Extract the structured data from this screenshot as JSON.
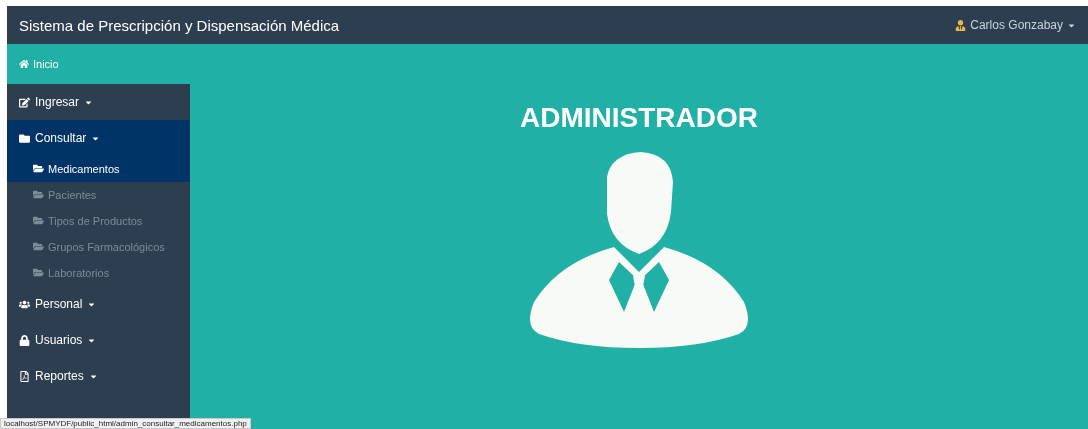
{
  "navbar": {
    "title": "Sistema de Prescripción y Dispensación Médica",
    "user": "Carlos Gonzabay"
  },
  "home_link": {
    "label": "Inicio"
  },
  "sidebar": {
    "items": [
      {
        "label": "Ingresar",
        "selected": false
      },
      {
        "label": "Consultar",
        "selected": true,
        "children": [
          {
            "label": "Medicamentos",
            "selected": true
          },
          {
            "label": "Pacientes",
            "selected": false
          },
          {
            "label": "Tipos de Productos",
            "selected": false
          },
          {
            "label": "Grupos Farmacológicos",
            "selected": false
          },
          {
            "label": "Laboratorios",
            "selected": false
          }
        ]
      },
      {
        "label": "Personal",
        "selected": false
      },
      {
        "label": "Usuarios",
        "selected": false
      },
      {
        "label": "Reportes",
        "selected": false
      }
    ]
  },
  "main": {
    "heading": "ADMINISTRADOR"
  },
  "status_bar": {
    "url": "localhost/SPMYDF/public_html/admin_consultar_medicamentos.php"
  }
}
